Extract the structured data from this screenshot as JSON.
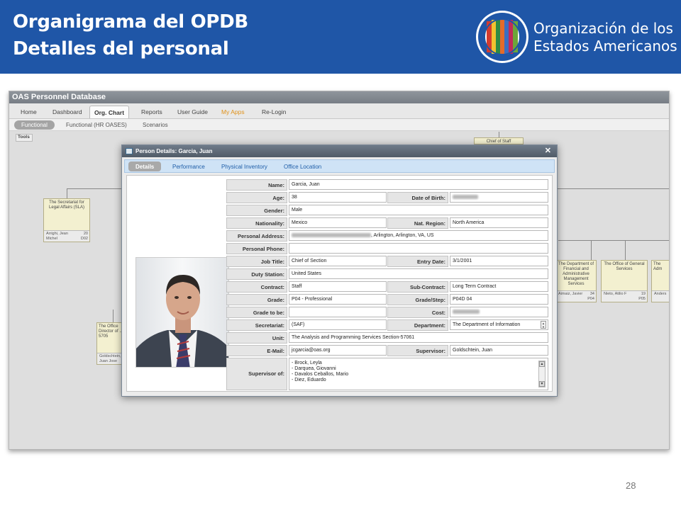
{
  "slide": {
    "title_line1": "Organigrama del OPDB",
    "title_line2": "Detalles del personal",
    "org_line1": "Organización de los",
    "org_line2": "Estados Americanos",
    "page_number": "28",
    "colors": {
      "header_bg": "#1f56a7",
      "org_box": "#f3f0d0",
      "tab_bar": "#cfe3f6"
    }
  },
  "app": {
    "title": "OAS Personnel Database",
    "nav": [
      "Home",
      "Dashboard",
      "Org. Chart",
      "Reports",
      "User Guide",
      "My Apps",
      "Re-Login"
    ],
    "active_nav": "Org. Chart",
    "subnav": [
      "Functional",
      "Functional (HR OASES)",
      "Scenarios"
    ],
    "active_subnav": "Functional",
    "tools_label": "Tools"
  },
  "orgchart": {
    "chief_of_staff": "Chief of Staff",
    "legal": {
      "name": "The Secretariat for Legal Affairs (SLA)",
      "person": "Arrighi, Jean Michel",
      "code_top": "20",
      "code_bottom": "D02"
    },
    "office_director": {
      "name": "The Office Director of ... 5705",
      "person": "Goldschtein, Juan Jose"
    },
    "dfams": {
      "name": "The Department of Financial and Administrative Management Services",
      "person": "Aimaiz, Javier",
      "code_top": "34",
      "code_bottom": "P04"
    },
    "general_services": {
      "name": "The Office of General Services",
      "person": "Nieto, Atilio F",
      "code_top": "19",
      "code_bottom": "P05"
    },
    "adm": {
      "name": "The Adm",
      "person": "Anders"
    }
  },
  "dialog": {
    "title": "Person Details: Garcia, Juan",
    "close_glyph": "✕",
    "tabs": [
      "Details",
      "Performance",
      "Physical Inventory",
      "Office Location"
    ],
    "active_tab": "Details",
    "fields": {
      "name": {
        "label": "Name:",
        "value": "Garcia, Juan"
      },
      "age": {
        "label": "Age:",
        "value": "38"
      },
      "date_of_birth": {
        "label": "Date of Birth:"
      },
      "gender": {
        "label": "Gender:",
        "value": "Male"
      },
      "nationality": {
        "label": "Nationality:",
        "value": "Mexico"
      },
      "nat_region": {
        "label": "Nat. Region:",
        "value": "North America"
      },
      "personal_address": {
        "label": "Personal Address:",
        "value_suffix": ", Arlington, Arlington, VA, US"
      },
      "personal_phone": {
        "label": "Personal Phone:",
        "value": ""
      },
      "job_title": {
        "label": "Job Title:",
        "value": "Chief of Section"
      },
      "entry_date": {
        "label": "Entry Date:",
        "value": "3/1/2001"
      },
      "duty_station": {
        "label": "Duty Station:",
        "value": "United States"
      },
      "contract": {
        "label": "Contract:",
        "value": "Staff"
      },
      "sub_contract": {
        "label": "Sub-Contract:",
        "value": "Long Term Contract"
      },
      "grade": {
        "label": "Grade:",
        "value": "P04 - Professional"
      },
      "grade_step": {
        "label": "Grade/Step:",
        "value": "P04D 04"
      },
      "grade_to_be": {
        "label": "Grade to be:",
        "value": ""
      },
      "cost": {
        "label": "Cost:"
      },
      "secretariat": {
        "label": "Secretariat:",
        "value": "(SAF)"
      },
      "department": {
        "label": "Department:",
        "value": "The Department of Information"
      },
      "unit": {
        "label": "Unit:",
        "value": "The Analysis and Programming Services Section-57061"
      },
      "email": {
        "label": "E-Mail:",
        "value": "jcgarcia@oas.org"
      },
      "supervisor": {
        "label": "Supervisor:",
        "value": "Goldschtein, Juan"
      },
      "supervisor_of": {
        "label": "Supervisor of:",
        "items": [
          "- Brock, Leyla",
          "- Darquea, Giovanni",
          "- Davalos Ceballos, Mario",
          "- Diez, Eduardo"
        ]
      }
    }
  }
}
